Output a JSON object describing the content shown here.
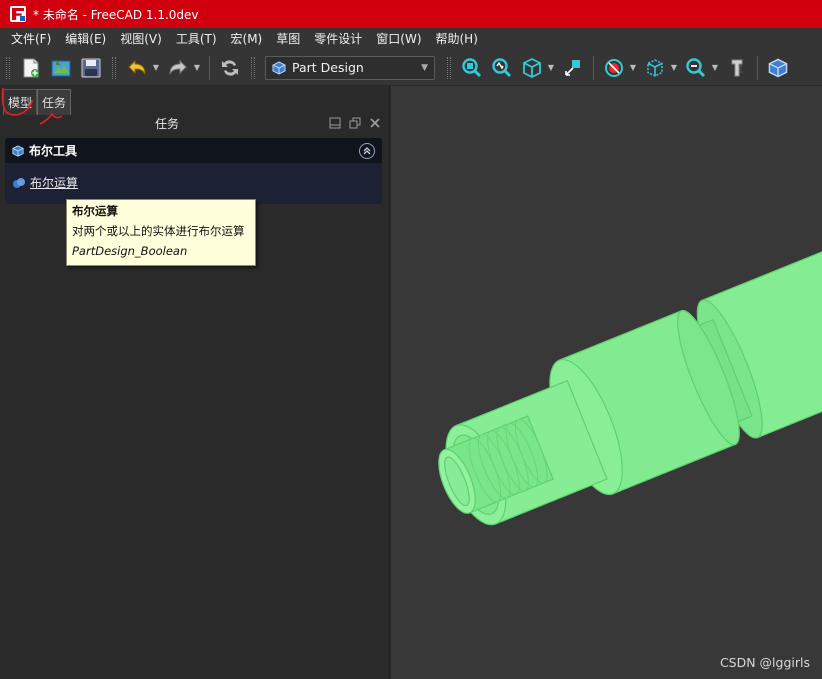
{
  "window": {
    "title": "* 未命名 - FreeCAD 1.1.0dev"
  },
  "menubar": {
    "items": [
      "文件(F)",
      "编辑(E)",
      "视图(V)",
      "工具(T)",
      "宏(M)",
      "草图",
      "零件设计",
      "窗口(W)",
      "帮助(H)"
    ]
  },
  "toolbar": {
    "workbench": "Part Design"
  },
  "left_panel": {
    "tabs": [
      "模型",
      "任务"
    ],
    "active_tab": "任务",
    "title": "任务"
  },
  "taskbox": {
    "title": "布尔工具",
    "command_label": "布尔运算"
  },
  "tooltip": {
    "title": "布尔运算",
    "description": "对两个或以上的实体进行布尔运算",
    "command": "PartDesign_Boolean"
  },
  "view3d": {
    "watermark": "CSDN @lggirls"
  },
  "colors": {
    "title_bar": "#d1000f",
    "shape_fill": "#7dea8e",
    "annotation": "#e02020"
  },
  "icons": [
    "new-document-icon",
    "open-file-icon",
    "save-icon",
    "undo-icon",
    "redo-icon",
    "refresh-icon",
    "part-design-icon",
    "fit-all-icon",
    "fit-selection-icon",
    "isometric-view-icon",
    "view-front-icon",
    "draw-style-icon",
    "bounding-box-icon",
    "zoom-icon",
    "measure-icon"
  ]
}
